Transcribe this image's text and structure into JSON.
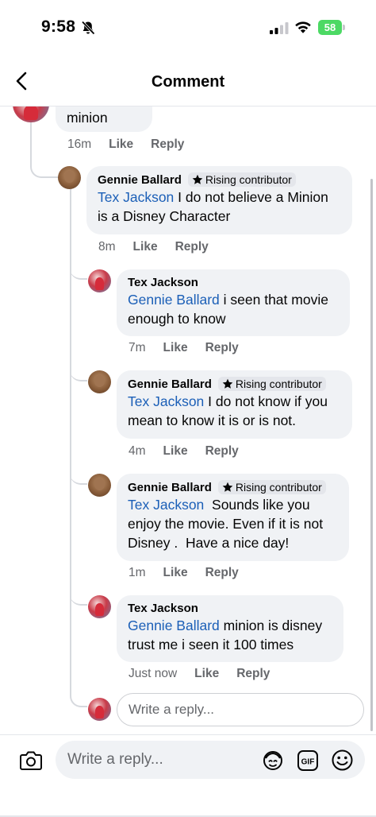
{
  "status_bar": {
    "time": "9:58",
    "battery": "58"
  },
  "header": {
    "title": "Comment"
  },
  "top_comment": {
    "text": "minion",
    "time": "16m",
    "like": "Like",
    "reply": "Reply"
  },
  "comments": [
    {
      "author": "Gennie Ballard",
      "badge": "Rising contributor",
      "mention": "Tex Jackson",
      "text_line1": " I do not believe a Minion",
      "text_line2": "is a Disney Character",
      "time": "8m",
      "like": "Like",
      "reply": "Reply"
    },
    {
      "author": "Tex Jackson",
      "mention": "Gennie Ballard",
      "text_line1": " i seen that movie",
      "text_line2": "enough to know",
      "time": "7m",
      "like": "Like",
      "reply": "Reply"
    },
    {
      "author": "Gennie Ballard",
      "badge": "Rising contributor",
      "mention": "Tex Jackson",
      "text_line1": " I do not know if you",
      "text_line2": "mean to know it is or is not.",
      "time": "4m",
      "like": "Like",
      "reply": "Reply"
    },
    {
      "author": "Gennie Ballard",
      "badge": "Rising contributor",
      "mention": "Tex Jackson",
      "text_line1": "  Sounds like you",
      "text_line2": "enjoy the movie. Even if it is not",
      "text_line3": "Disney .  Have a nice day!",
      "time": "1m",
      "like": "Like",
      "reply": "Reply"
    },
    {
      "author": "Tex Jackson",
      "mention": "Gennie Ballard",
      "text_line1": " minion is disney",
      "text_line2": "trust me i seen it 100 times",
      "time": "Just now",
      "like": "Like",
      "reply": "Reply"
    }
  ],
  "thread_reply": {
    "placeholder": "Write a reply..."
  },
  "composer": {
    "placeholder": "Write a reply..."
  },
  "icons": {
    "back": "chevron-left-icon",
    "camera": "camera-icon",
    "sticker": "avatar-sticker-icon",
    "gif": "gif-icon",
    "emoji": "emoji-icon"
  },
  "colors": {
    "mention": "#1b5fb7",
    "bubble": "#f0f2f5",
    "battery": "#4cd964"
  }
}
